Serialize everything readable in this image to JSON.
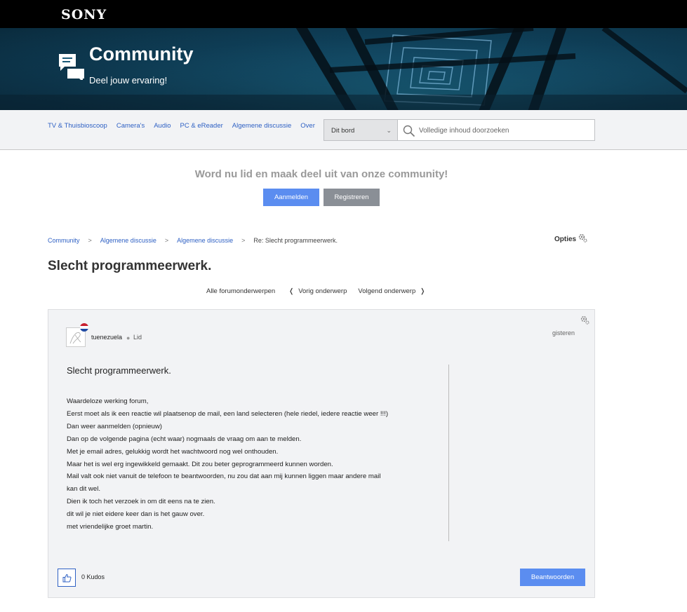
{
  "brand": "SONY",
  "hero": {
    "title": "Community",
    "subtitle": "Deel jouw ervaring!"
  },
  "nav": {
    "items": [
      "TV & Thuisbioscoop",
      "Camera's",
      "Audio",
      "PC & eReader",
      "Algemene discussie",
      "Over"
    ],
    "board_select": "Dit bord",
    "search_placeholder": "Volledige inhoud doorzoeken"
  },
  "join": {
    "text": "Word nu lid en maak deel uit van onze community!",
    "login_label": "Aanmelden",
    "register_label": "Registreren"
  },
  "breadcrumb": {
    "items": [
      "Community",
      "Algemene discussie",
      "Algemene discussie"
    ],
    "current": "Re: Slecht programmeerwerk."
  },
  "options_label": "Opties",
  "page_title": "Slecht programmeerwerk.",
  "topic_nav": {
    "all": "Alle forumonderwerpen",
    "prev": "Vorig onderwerp",
    "next": "Volgend onderwerp"
  },
  "post": {
    "username": "tuenezuela",
    "rank": "Lid",
    "date": "gisteren",
    "subject": "Slecht programmeerwerk.",
    "body_lines": [
      "Waardeloze werking forum,",
      "Eerst moet als ik een reactie wil plaatsenop de mail, een land selecteren (hele riedel, iedere reactie weer !!!)",
      "Dan weer aanmelden (opnieuw)",
      "Dan op de volgende pagina (echt waar) nogmaals de vraag om aan te melden.",
      "Met je email adres, gelukkig wordt het wachtwoord nog wel onthouden.",
      "Maar het is wel erg ingewikkeld gemaakt. Dit zou beter geprogrammeerd kunnen worden.",
      "Mail valt ook niet vanuit de telefoon te beantwoorden, nu zou dat aan mij kunnen liggen maar andere mail",
      "kan dit wel.",
      "Dien ik toch het verzoek in om dit eens na te zien.",
      "dit wil je niet eidere keer dan is het gauw over.",
      "met vriendelijke groet martin."
    ],
    "kudos": "0 Kudos",
    "reply_label": "Beantwoorden"
  },
  "colors": {
    "accent": "#5b8df0",
    "link": "#2f61c4",
    "secondary_button": "#8a8f96",
    "header_bg": "#000000"
  },
  "icons": [
    "speech-bubbles-icon",
    "search-icon",
    "chevron-down-icon",
    "gear-icon",
    "thumbs-up-icon",
    "chevron-left-icon",
    "chevron-right-icon"
  ]
}
